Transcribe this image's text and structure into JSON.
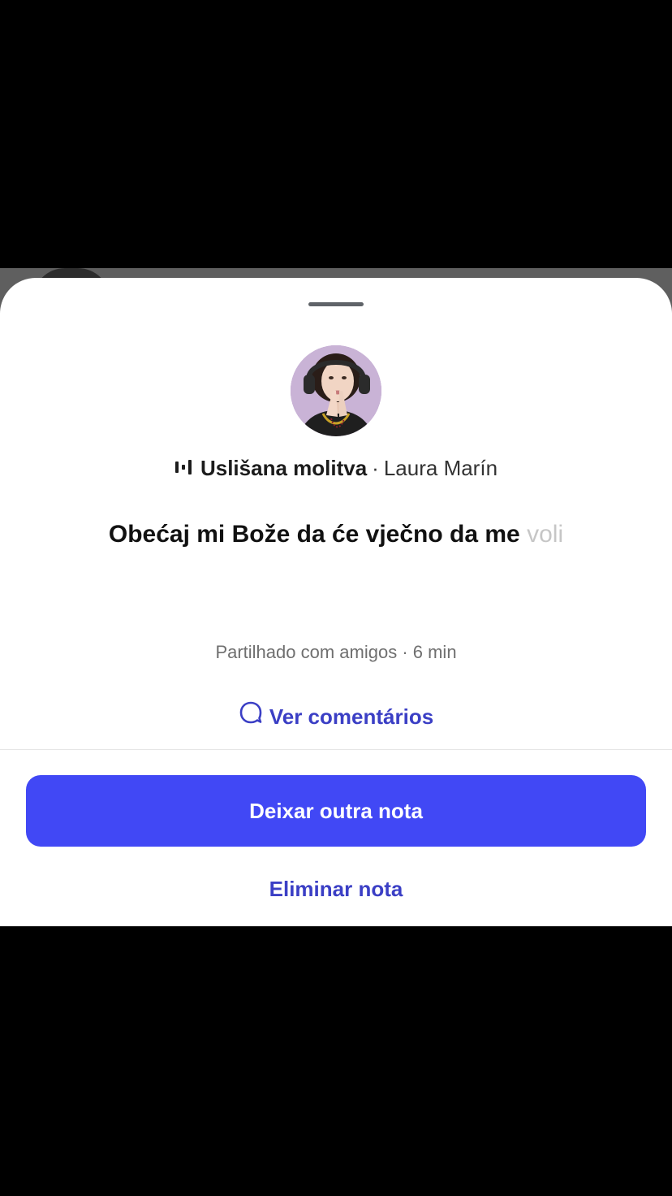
{
  "note": {
    "song_title": "Uslišana molitva",
    "separator": "·",
    "artist": "Laura Marín",
    "lyric_main": "Obećaj mi Bože da će vječno da me",
    "lyric_faded": "voli",
    "meta": "Partilhado com amigos · 6 min"
  },
  "actions": {
    "comments_label": "Ver comentários",
    "primary_label": "Deixar outra nota",
    "delete_label": "Eliminar nota"
  },
  "icons": {
    "music": "music-bars-icon",
    "comment": "speech-bubble-icon"
  },
  "colors": {
    "accent": "#4148f5",
    "link": "#3b3fc5",
    "faded_text": "#c6c6c6",
    "meta_text": "#6f6f6f"
  }
}
